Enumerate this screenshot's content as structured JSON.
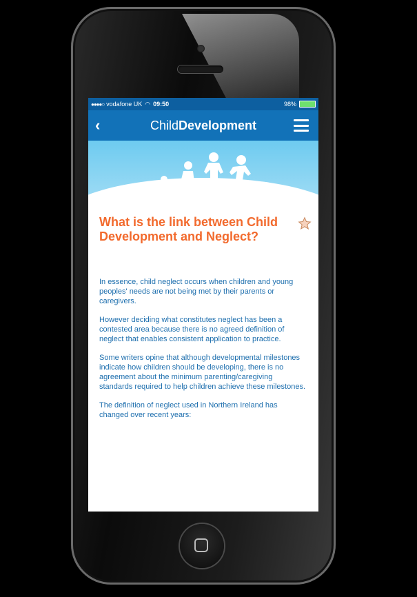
{
  "status": {
    "carrier": "vodafone UK",
    "time": "09:50",
    "battery": "98%"
  },
  "nav": {
    "title_light": "Child",
    "title_bold": "Development"
  },
  "article": {
    "heading": "What is the link between Child Development and Neglect?",
    "paragraphs": [
      "In essence, child neglect occurs when children and young peoples' needs are not being met by their parents or caregivers.",
      "However deciding what constitutes neglect has been a contested area because there is no agreed definition of neglect that enables consistent application to practice.",
      "Some writers opine that although developmental milestones indicate how children should be developing, there is no agreement about the minimum parenting/caregiving standards required to help children achieve these milestones.",
      "The definition of neglect used in Northern Ireland has changed over recent years:"
    ]
  },
  "colors": {
    "nav_bg": "#1272b8",
    "heading": "#f26a2d",
    "body_text": "#1e6fae"
  }
}
